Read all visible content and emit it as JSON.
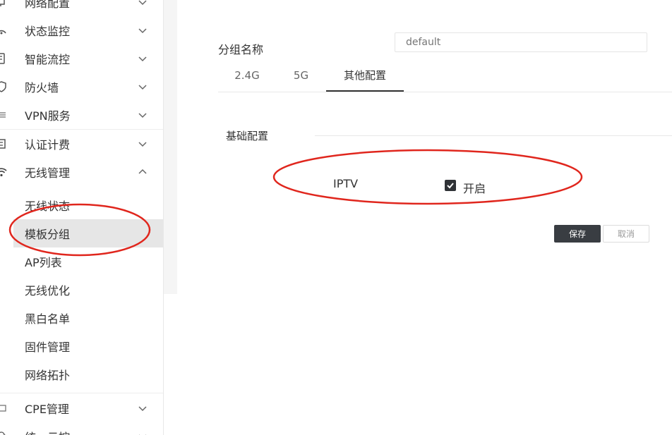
{
  "sidebar": {
    "menu": [
      {
        "label": "网络配置",
        "icon": "network-icon"
      },
      {
        "label": "状态监控",
        "icon": "monitor-icon"
      },
      {
        "label": "智能流控",
        "icon": "flow-control-icon"
      },
      {
        "label": "防火墙",
        "icon": "shield-icon"
      },
      {
        "label": "VPN服务",
        "icon": "vpn-icon"
      },
      {
        "label": "认证计费",
        "icon": "auth-icon"
      },
      {
        "label": "无线管理",
        "icon": "wifi-icon"
      }
    ],
    "wireless_submenu": [
      "无线状态",
      "模板分组",
      "AP列表",
      "无线优化",
      "黑白名单",
      "固件管理",
      "网络拓扑"
    ],
    "active_subitem": "模板分组",
    "menu_after": [
      {
        "label": "CPE管理",
        "icon": "cpe-icon"
      },
      {
        "label": "统一云控",
        "icon": "cloud-icon"
      }
    ]
  },
  "form": {
    "group_name_label": "分组名称",
    "group_name_placeholder": "default"
  },
  "tabs": [
    "2.4G",
    "5G",
    "其他配置"
  ],
  "active_tab": "其他配置",
  "section": {
    "title": "基础配置"
  },
  "iptv": {
    "label": "IPTV",
    "enabled": true,
    "checkbox_label": "开启"
  },
  "buttons": {
    "save": "保存",
    "cancel": "取消"
  },
  "colors": {
    "annotation": "#e0261d",
    "active_tab_underline": "#333333",
    "save_button_bg": "#393d42",
    "active_menu_bg": "#e6e6e6"
  }
}
